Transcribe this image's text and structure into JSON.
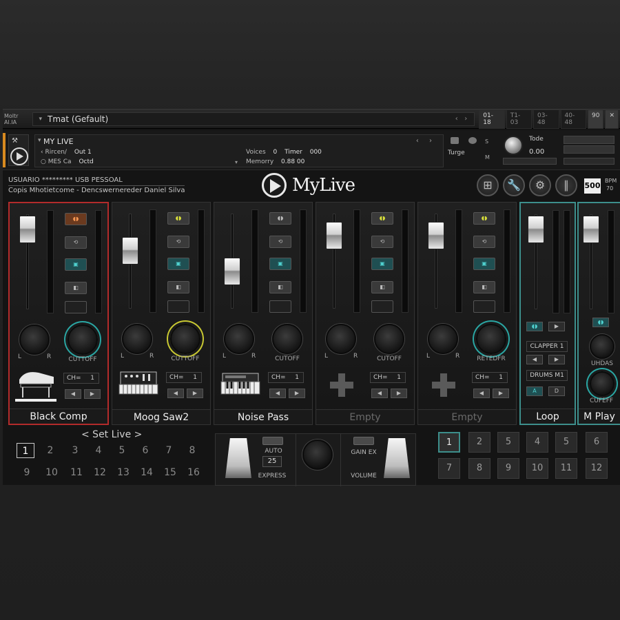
{
  "topbar": {
    "mini_logo": [
      "Moltr",
      "Al.IA"
    ],
    "preset": "Tmat (Gefault)",
    "ranges": [
      "01-18",
      "T1-03",
      "03-48",
      "40-48",
      "90"
    ]
  },
  "instrument": {
    "name": "MY LIVE",
    "row1_label": "Rircen/",
    "row1_value": "Out 1",
    "row2_label": "MES Ca",
    "row2_value": "Octd",
    "voices_label": "Voices",
    "voices_value": "0",
    "timer_label": "Timer",
    "timer_value": "000",
    "memory_label": "Memorry",
    "memory_value": "0.88 00",
    "tune_side": "Turge",
    "s_label": "S",
    "m_label": "M",
    "tune_label": "Tode",
    "tune_value": "0.00"
  },
  "brand": {
    "line1": "USUARIO ********* USB PESSOAL",
    "line2": "Copis Mhotietcome - Dencswernereder Daniel Silva",
    "name": "MyLive",
    "bpm_value": "500",
    "bpm_label": "BPM",
    "bpm_sub": "70"
  },
  "strips": [
    {
      "name": "Black Comp",
      "knob_label": "CUTTOFF",
      "ch_label": "CH=",
      "ch_value": "1",
      "dim": false
    },
    {
      "name": "Moog Saw2",
      "knob_label": "CUTTOFF",
      "ch_label": "CH=",
      "ch_value": "1",
      "dim": false
    },
    {
      "name": "Noise Pass",
      "knob_label": "CUTOFF",
      "ch_label": "CH=",
      "ch_value": "1",
      "dim": false
    },
    {
      "name": "Empty",
      "knob_label": "CUTOFF",
      "ch_label": "CH=",
      "ch_value": "1",
      "dim": true
    },
    {
      "name": "Empty",
      "knob_label": "RETEDFR",
      "ch_label": "CH=",
      "ch_value": "1",
      "dim": true
    },
    {
      "name": "Loop",
      "row1": "CLAPPER 1",
      "row2": "DRUMS M1",
      "btn_a": "A",
      "btn_b": "D"
    },
    {
      "name": "M Play",
      "knob1_label": "UHDAS",
      "knob2_label": "CUFEFF"
    }
  ],
  "lr": {
    "l": "L",
    "r": "R"
  },
  "set_live": {
    "title": "< Set Live >",
    "numbers": [
      "1",
      "2",
      "3",
      "4",
      "5",
      "6",
      "7",
      "8",
      "9",
      "10",
      "11",
      "12",
      "13",
      "14",
      "15",
      "16"
    ],
    "active": "1"
  },
  "expression": {
    "auto_label": "AUTO",
    "auto_value": "25",
    "express_label": "EXPRESS",
    "gain_label": "GAIN EX",
    "volume_label": "VOLUME"
  },
  "pads": {
    "row1": [
      "1",
      "2",
      "5",
      "4",
      "5",
      "6"
    ],
    "row2": [
      "7",
      "8",
      "9",
      "10",
      "11",
      "12"
    ],
    "active": "1"
  },
  "colors": {
    "selected_red": "#b32b2b",
    "selected_teal": "#3d8f8c",
    "accent_orange": "#d88a1f"
  }
}
